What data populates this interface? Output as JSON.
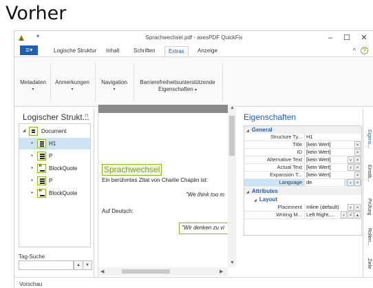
{
  "heading": "Vorher",
  "window": {
    "title": "Sprachwechsel.pdf - axesPDF QuickFix",
    "minimize": "–",
    "maximize": "☐",
    "close": "✕"
  },
  "menu": {
    "file_icon": "menu-icon",
    "tabs": [
      "Logische Struktur",
      "Inhalt",
      "Schriften",
      "Extras",
      "Anzeige"
    ],
    "active_tab": "Extras",
    "collapse": "^",
    "help": "?"
  },
  "ribbon": {
    "groups": [
      "Metadaten",
      "Anmerkungen",
      "Navigation"
    ],
    "accessibility_line1": "Barrierefreiheitsunterstützende",
    "accessibility_line2": "Eigenschaften"
  },
  "left_pane": {
    "title": "Logischer Strukt...",
    "tree": [
      {
        "label": "Document",
        "icon": "document-icon"
      },
      {
        "label": "H1",
        "icon": "heading-icon"
      },
      {
        "label": "P",
        "icon": "paragraph-icon"
      },
      {
        "label": "BlockQuote",
        "icon": "blockquote-icon"
      },
      {
        "label": "P",
        "icon": "paragraph-icon"
      },
      {
        "label": "BlockQuote",
        "icon": "blockquote-icon"
      }
    ],
    "selected": "H1",
    "tag_search_label": "Tag-Suche",
    "tag_search_value": ""
  },
  "document": {
    "heading": "Sprachwechsel",
    "p1": "Ein berühmtes Zitat von Charlie Chaplin ist:",
    "quote1": "\"We think too m",
    "p2": "Auf Deutsch:",
    "quote2": "\"Wir denken zu vi"
  },
  "properties": {
    "title": "Eigenschaften",
    "general_label": "General",
    "general": [
      {
        "name": "Structure Ty...",
        "value": "H1"
      },
      {
        "name": "Title",
        "value": "[kein Wert]"
      },
      {
        "name": "ID",
        "value": "[kein Wert]"
      },
      {
        "name": "Alternative Text",
        "value": "[kein Wert]"
      },
      {
        "name": "Actual Text",
        "value": "[kein Wert]"
      },
      {
        "name": "Expansion T...",
        "value": "[kein Wert]"
      },
      {
        "name": "Language",
        "value": "de"
      }
    ],
    "attributes_label": "Attributes",
    "layout_label": "Layout",
    "layout": [
      {
        "name": "Placement",
        "value": "Inline (default)"
      },
      {
        "name": "Writing M...",
        "value": "Left Right,..."
      }
    ]
  },
  "side_tabs": [
    "Eigens...",
    "Einstb...",
    "Prüfung",
    "Rollen...",
    "Ziele"
  ],
  "status": "Vorschau",
  "colors": {
    "accent": "#1e5fb4",
    "tag_green": "#8ab41e"
  }
}
